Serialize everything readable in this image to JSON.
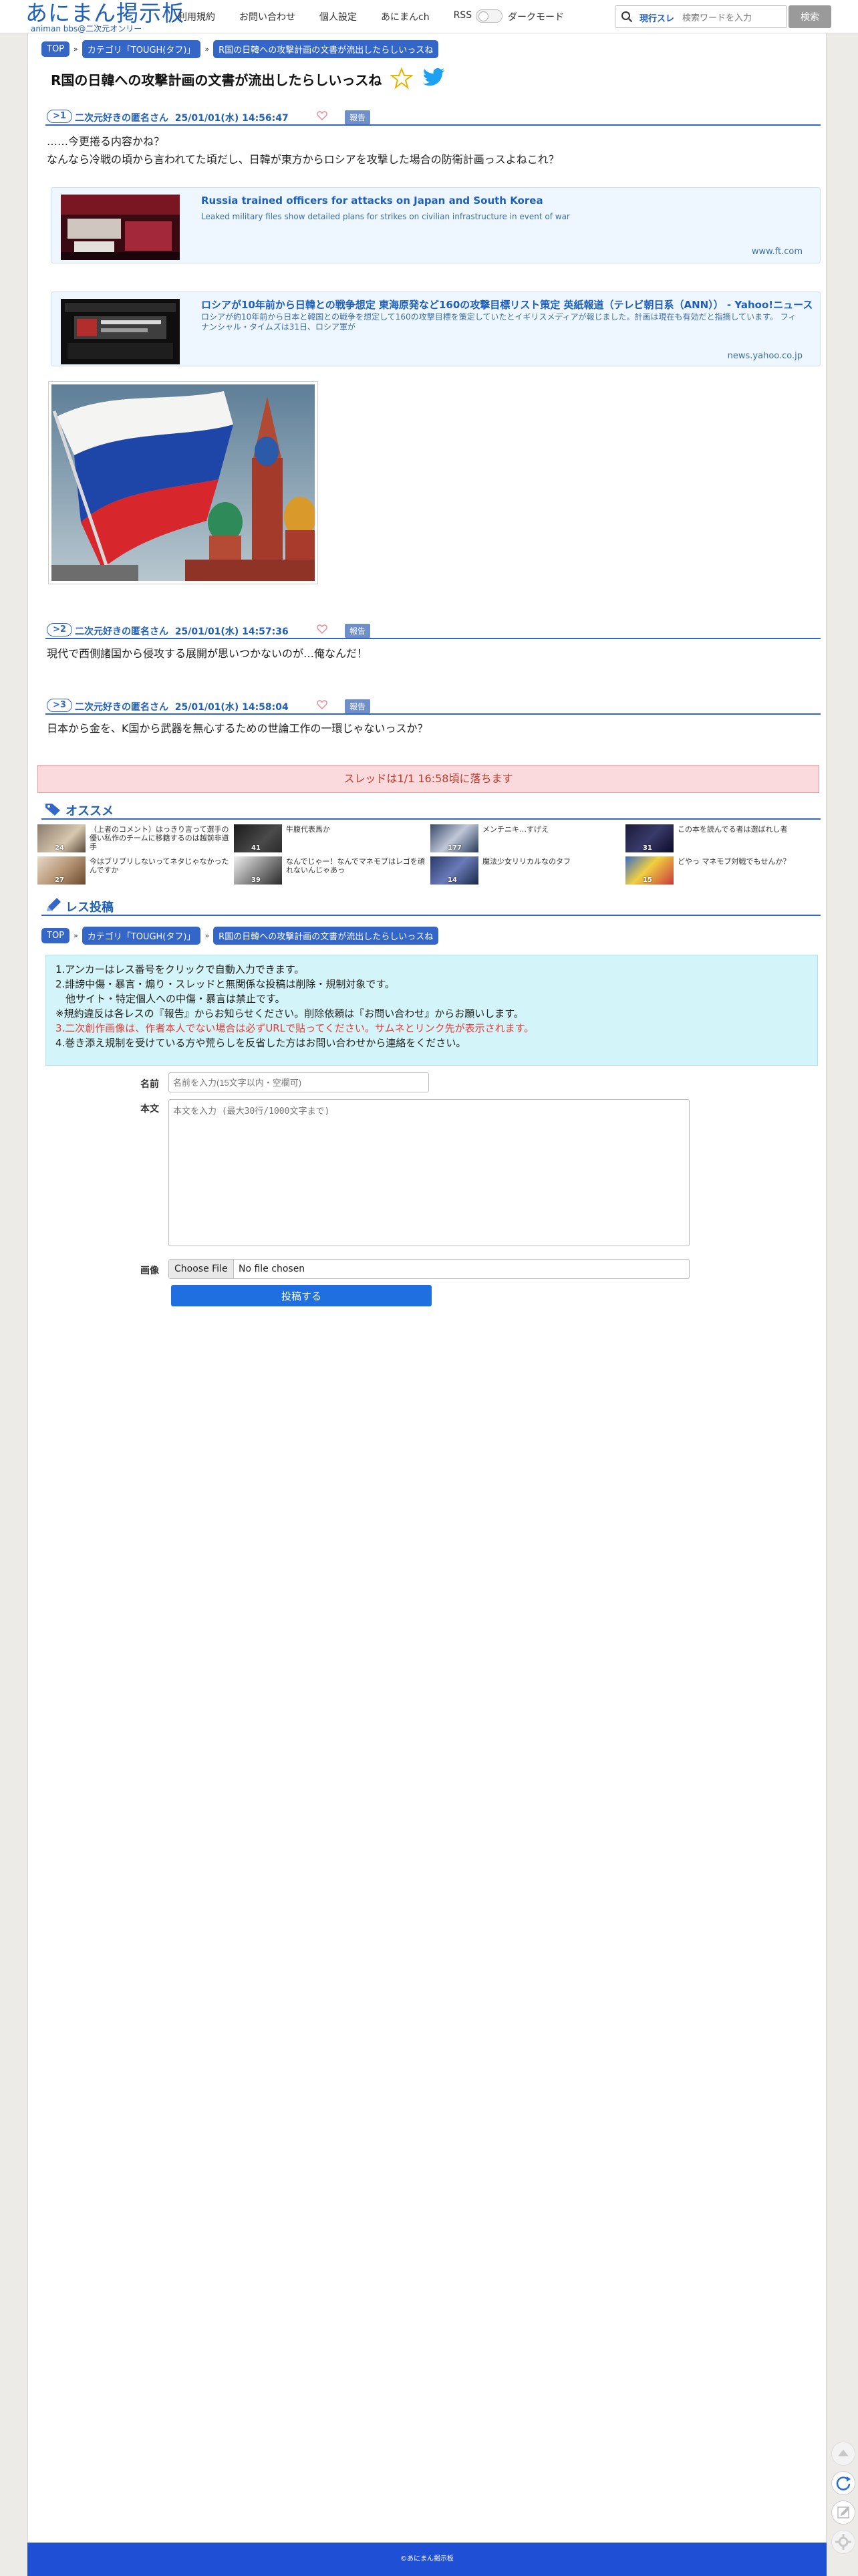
{
  "header": {
    "logo_title": "あにまん掲示板",
    "logo_sub": "animan bbs@二次元オンリー",
    "nav": [
      "利用規約",
      "お問い合わせ",
      "個人設定",
      "あにまんch",
      "RSS"
    ],
    "dark_mode_label": "ダークモード",
    "search_scope": "現行スレ",
    "search_placeholder": "検索ワードを入力",
    "search_button": "検索"
  },
  "breadcrumb": [
    "TOP",
    "カテゴリ「TOUGH(タフ)」",
    "R国の日韓への攻撃計画の文書が流出したらしいっスね"
  ],
  "thread_title": "R国の日韓への攻撃計画の文書が流出したらしいっスね",
  "report_label": "報告",
  "posts": [
    {
      "num": ">1",
      "name": "二次元好きの匿名さん",
      "date": "25/01/01(水) 14:56:47",
      "lines": [
        "……今更捲る内容かね？",
        "なんなら冷戦の頃から言われてた頃だし、日韓が東方からロシアを攻撃した場合の防衛計画っスよねこれ？"
      ]
    },
    {
      "num": ">2",
      "name": "二次元好きの匿名さん",
      "date": "25/01/01(水) 14:57:36",
      "lines": [
        "現代で西側諸国から侵攻する展開が思いつかないのが…俺なんだ！"
      ]
    },
    {
      "num": ">3",
      "name": "二次元好きの匿名さん",
      "date": "25/01/01(水) 14:58:04",
      "lines": [
        "日本から金を、K国から武器を無心するための世論工作の一環じゃないっスか？"
      ]
    }
  ],
  "link_cards": [
    {
      "title": "Russia trained officers for attacks on Japan and South Korea",
      "desc": "Leaked military files show detailed plans for strikes on civilian infrastructure in event of war",
      "domain": "www.ft.com"
    },
    {
      "title": "ロシアが10年前から日韓との戦争想定 東海原発など160の攻撃目標リスト策定 英紙報道（テレビ朝日系（ANN）） - Yahoo!ニュース",
      "desc": "ロシアが約10年前から日本と韓国との戦争を想定して160の攻撃目標を策定していたとイギリスメディアが報じました。計画は現在も有効だと指摘しています。 フィナンシャル・タイムズは31日、ロシア軍が",
      "domain": "news.yahoo.co.jp"
    }
  ],
  "notice": "スレッドは1/1 16:58頃に落ちます",
  "recommend": {
    "title": "オススメ",
    "items": [
      {
        "text": "（上者のコメント）はっきり言って選手の優い私作のチームに移籍するのは越前非道手",
        "count": "24"
      },
      {
        "text": "牛腹代表馬か",
        "count": "41"
      },
      {
        "text": "メンチニキ…すげえ",
        "count": "177"
      },
      {
        "text": "この本を読んでる者は選ばれし者",
        "count": "31"
      },
      {
        "text": "今はブリブリしないってネタじゃなかったんですか",
        "count": "27"
      },
      {
        "text": "なんでじゃー！なんでマネモブはレゴを頑れないんじゃあっ",
        "count": "39"
      },
      {
        "text": "魔法少女リリカルなのタフ",
        "count": "14"
      },
      {
        "text": "どやっ マネモブ対戦でもせんか？",
        "count": "15"
      }
    ]
  },
  "post_section_title": "レス投稿",
  "rules": [
    "1.アンカーはレス番号をクリックで自動入力できます。",
    "2.誹謗中傷・暴言・煽り・スレッドと無関係な投稿は削除・規制対象です。",
    "　他サイト・特定個人への中傷・暴言は禁止です。",
    "※規約違反は各レスの『報告』からお知らせください。削除依頼は『お問い合わせ』からお願いします。",
    "3.二次創作画像は、作者本人でない場合は必ずURLで貼ってください。サムネとリンク先が表示されます。",
    "4.巻き添え規制を受けている方や荒らしを反省した方はお問い合わせから連絡をください。"
  ],
  "form": {
    "name_label": "名前",
    "name_placeholder": "名前を入力(15文字以内・空欄可)",
    "body_label": "本文",
    "body_placeholder": "本文を入力 (最大30行/1000文字まで)",
    "image_label": "画像",
    "file_button": "Choose File",
    "file_status": "No file chosen",
    "submit": "投稿する"
  },
  "footer": "©あにまん掲示板",
  "colors": {
    "accent": "#3466c8",
    "link": "#1f5fb7",
    "notice_bg": "#fadadd",
    "rules_bg": "#d3f4f8",
    "footer_bg": "#1f4fd4"
  }
}
